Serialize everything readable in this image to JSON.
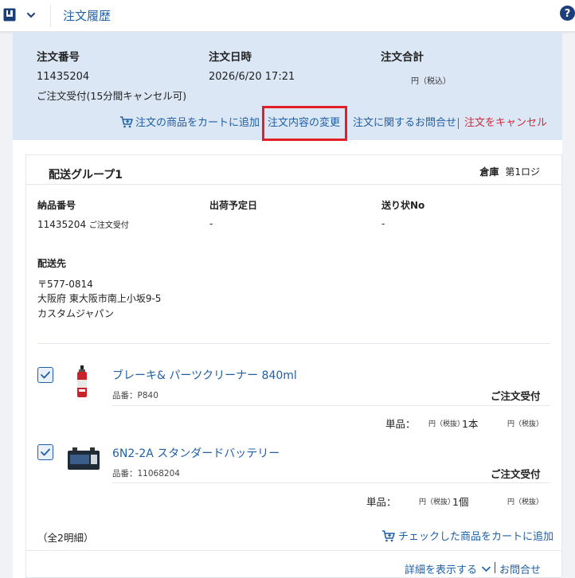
{
  "header": {
    "title": "注文履歴"
  },
  "order": {
    "number_label": "注文番号",
    "number": "11435204",
    "status": "ご注文受付(15分間キャンセル可)",
    "datetime_label": "注文日時",
    "datetime": "2026/6/20 17:21",
    "total_label": "注文合計",
    "total_unit": "円（税込）"
  },
  "actions": {
    "add_to_cart": "注文の商品をカートに追加",
    "change": "注文内容の変更",
    "inquiry": "注文に関するお問合せ",
    "cancel": "注文をキャンセル"
  },
  "group": {
    "title": "配送グループ1",
    "warehouse_label": "倉庫",
    "warehouse": "第1ロジ",
    "delivery_no_label": "納品番号",
    "delivery_no": "11435204",
    "delivery_status": "ご注文受付",
    "ship_date_label": "出荷予定日",
    "ship_date": "-",
    "invoice_label": "送り状No",
    "invoice": "-",
    "dest_label": "配送先",
    "postal": "〒577-0814",
    "address": "大阪府 東大阪市南上小坂9-5",
    "recipient": "カスタムジャパン"
  },
  "items": [
    {
      "name": "ブレーキ& パーツクリーナー 840ml",
      "code": "品番：P840",
      "status": "ご注文受付",
      "unit_label": "単品：",
      "unit_price": "円（税抜）",
      "qty": "1本",
      "subtotal": "円（税抜）",
      "checked": true
    },
    {
      "name": "6N2-2A スタンダードバッテリー",
      "code": "品番：11068204",
      "status": "ご注文受付",
      "unit_label": "単品：",
      "unit_price": "円（税抜）",
      "qty": "1個",
      "subtotal": "円（税抜）",
      "checked": true
    }
  ],
  "footer": {
    "count": "（全2明細）",
    "add_checked": "チェックした商品をカートに追加",
    "details": "詳細を表示する",
    "inquiry": "お問合せ"
  },
  "colors": {
    "accent": "#1f5fa6",
    "summary_bg": "#dbe7f4",
    "danger": "#d6283b",
    "highlight": "#e21f26"
  }
}
